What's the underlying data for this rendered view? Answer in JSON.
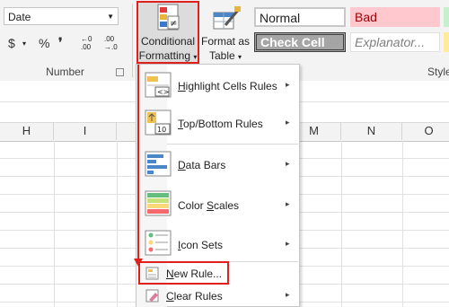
{
  "ribbon": {
    "number_format": "Date",
    "dollar": "$",
    "dollar_dd": "▾",
    "percent": "%",
    "comma": "❜",
    "inc_decimal_top": "←0",
    "inc_decimal_bottom": ".00",
    "dec_decimal_top": ".00",
    "dec_decimal_bottom": "→.0",
    "group_number": "Number",
    "cf_line1": "Conditional",
    "cf_line2": "Formatting",
    "cf_dd": "▾",
    "fat_line1": "Format as",
    "fat_line2": "Table",
    "fat_dd": "▾",
    "group_styles": "Style",
    "styles": {
      "normal": "Normal",
      "bad": "Bad",
      "check_cell": "Check Cell",
      "explanatory": "Explanator..."
    }
  },
  "grid": {
    "columns": [
      "H",
      "I",
      "M",
      "N",
      "O"
    ]
  },
  "menu": {
    "highlight": "Highlight Cells Rules",
    "highlight_key": "H",
    "topbottom": "Top/Bottom Rules",
    "topbottom_key": "T",
    "databars": "Data Bars",
    "databars_key": "D",
    "colorscales": "Color Scales",
    "colorscales_key": "S",
    "iconsets": "Icon Sets",
    "iconsets_key": "I",
    "newrule": "New Rule...",
    "newrule_key": "N",
    "clearrules": "Clear Rules",
    "clearrules_key": "C",
    "topbottom_icon_num": "10",
    "arrow": "▸"
  },
  "colors": {
    "highlight_red": "#e0201d",
    "bad_bg": "#ffc7ce",
    "bad_text": "#9c0006",
    "check_bg": "#a5a5a5"
  }
}
